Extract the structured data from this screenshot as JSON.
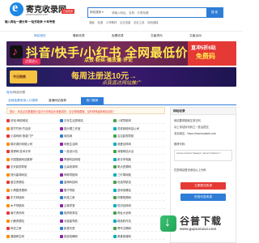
{
  "header": {
    "site_name": "寄克收录网",
    "badge": "已发现源",
    "url": "www.kuakeb.com",
    "slogan": "输入网址一键分享·一站式收录·十年专营",
    "search_select": "网站搜索 ▾",
    "search_placeholder": "请输入网址、名称、分享标题",
    "search_button": "搜 索",
    "hotwords": [
      "漫画",
      "动漫",
      "小学教材",
      "论文查重",
      "站长工具",
      "网页链接"
    ]
  },
  "nav": {
    "home": "网站首页",
    "items": [
      "最新收录",
      "免费收录",
      "文章资讯",
      "文章活动"
    ]
  },
  "banner1": {
    "title": "抖音/快手/小红书 全网最低价",
    "subtitle": "点赞·粉丝·播放量·评论",
    "cta": "点我进入",
    "side_top": "直冲5折6站",
    "side_bottom": "免费码"
  },
  "banner2": {
    "logo_text": "今日热卖",
    "title": "每周注册送10元→",
    "subtitle": "点我直达网站推广"
  },
  "breadcrumb": {
    "home": "首页",
    "current": "/网站列表"
  },
  "tabs": {
    "first": "全网免费收录入口推荐",
    "second": "普通网站推荐",
    "active": "热门推荐"
  },
  "notice": "提示：本站点击数据统计显示分享网站大家都说好，请记得收藏哦，及时获得最新网站动态！",
  "listing": [
    [
      "铃铛·网络网站",
      "日本生活类网站",
      "八戒导航网"
    ],
    [
      "夏竹竹网·竹百收",
      "猫头鹰工作室",
      "苏轼网络科技公司"
    ],
    [
      "小游戏网·旅游门户",
      "哈哈网",
      "吉吉影视导航"
    ],
    [
      "锦天城乐网络公司",
      "闲鱼生活网",
      "我爱百科网"
    ],
    [
      "赛博网·技术分享",
      "一品设计站",
      "泽程网站大全"
    ],
    [
      "中国搜索网站推荐",
      "青瓷科技网络",
      "新手学电脑"
    ],
    [
      "天天影视导航",
      "云朵收录网",
      "奇点资源网"
    ],
    [
      "快乐星球网站",
      "神奇导航网",
      "三叶草网络"
    ],
    [
      "星空资源站",
      "蓝海科技网",
      "优选导航站"
    ],
    [
      "小黑屋资源网",
      "橙子导航",
      "游戏攻略站"
    ],
    [
      "东方财经网",
      "科技之家",
      "好看视频网"
    ],
    [
      "木子导航网",
      "云端学堂",
      "知识百科网"
    ],
    [
      "南方资讯网",
      "极简收录站",
      "网址大全网"
    ],
    [
      "小鹿资源站",
      "北极星导航",
      "精品软件站"
    ],
    [
      "码农之家",
      "影视天堂",
      "青年文摘网"
    ],
    [
      "健康养生网",
      "旅游攻略网",
      "美食菜谱网"
    ]
  ],
  "sidebar": {
    "title": "网站收录",
    "line1": "网站要求能够正常访问",
    "line2": "请上传站标代码之一处后提交",
    "line3": "本站域名：https://www.kuakeb.com",
    "line4": "推荐代码：",
    "code": "<meta content=\"always\" name=\"referrer\">",
    "line5": "在您网站首页添加以上代码",
    "button1": "立即提交收录",
    "button2": "在线代发收录"
  },
  "watermark": {
    "title": "谷普下载",
    "url": "www.gupuxiazai.com"
  },
  "colors": {
    "primary": "#2e7dd7",
    "accent": "#e53935"
  }
}
